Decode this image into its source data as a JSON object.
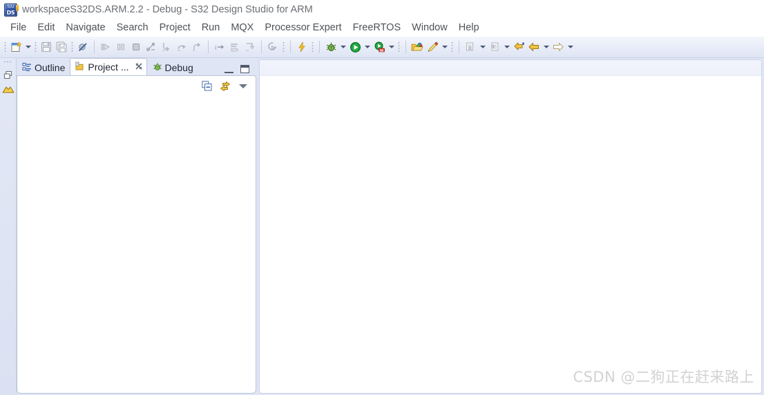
{
  "window": {
    "title": "workspaceS32DS.ARM.2.2 - Debug - S32 Design Studio for ARM",
    "app_icon": "s32ds-app-icon",
    "icon_top_text": "S32",
    "icon_bottom_text": "DS"
  },
  "menubar": {
    "items": [
      {
        "label": "File"
      },
      {
        "label": "Edit"
      },
      {
        "label": "Navigate"
      },
      {
        "label": "Search"
      },
      {
        "label": "Project"
      },
      {
        "label": "Run"
      },
      {
        "label": "MQX"
      },
      {
        "label": "Processor Expert"
      },
      {
        "label": "FreeRTOS"
      },
      {
        "label": "Window"
      },
      {
        "label": "Help"
      }
    ]
  },
  "toolbar": {
    "groups": [
      {
        "buttons": [
          {
            "name": "new-wizard-button",
            "icon": "new-file-icon",
            "enabled": true,
            "has_dropdown": true
          },
          {
            "name": "save-button",
            "icon": "save-icon",
            "enabled": false
          },
          {
            "name": "save-all-button",
            "icon": "save-all-icon",
            "enabled": false
          },
          {
            "name": "skip-all-breakpoints-button",
            "icon": "skip-breakpoints-icon",
            "enabled": false
          }
        ]
      },
      {
        "buttons": [
          {
            "name": "resume-button",
            "icon": "resume-icon",
            "enabled": false
          },
          {
            "name": "suspend-button",
            "icon": "suspend-icon",
            "enabled": false
          },
          {
            "name": "terminate-button",
            "icon": "terminate-icon",
            "enabled": false
          },
          {
            "name": "disconnect-button",
            "icon": "disconnect-icon",
            "enabled": false
          },
          {
            "name": "step-into-button",
            "icon": "step-into-icon",
            "enabled": false
          },
          {
            "name": "step-over-button",
            "icon": "step-over-icon",
            "enabled": false
          },
          {
            "name": "step-return-button",
            "icon": "step-return-icon",
            "enabled": false
          }
        ]
      },
      {
        "buttons": [
          {
            "name": "instruction-stepping-button",
            "icon": "instruction-step-icon",
            "enabled": false
          },
          {
            "name": "drop-to-frame-button",
            "icon": "drop-to-frame-icon",
            "enabled": false
          },
          {
            "name": "step-into-selection-button",
            "icon": "step-into-selection-icon",
            "enabled": false
          }
        ]
      },
      {
        "buttons": [
          {
            "name": "restart-button",
            "icon": "restart-icon",
            "enabled": false
          }
        ]
      },
      {
        "buttons": [
          {
            "name": "build-button",
            "icon": "build-lightning-icon",
            "enabled": true
          }
        ]
      },
      {
        "buttons": [
          {
            "name": "debug-button",
            "icon": "debug-bug-icon",
            "enabled": true,
            "has_dropdown": true
          },
          {
            "name": "run-button",
            "icon": "run-play-icon",
            "enabled": true,
            "has_dropdown": true
          },
          {
            "name": "profile-button",
            "icon": "profile-icon",
            "enabled": true,
            "has_dropdown": true
          }
        ]
      },
      {
        "buttons": [
          {
            "name": "open-resource-button",
            "icon": "open-folder-icon",
            "enabled": true
          },
          {
            "name": "pin-editor-button",
            "icon": "marker-pencil-icon",
            "enabled": true,
            "has_dropdown": true
          }
        ]
      },
      {
        "buttons": [
          {
            "name": "next-annotation-button",
            "icon": "next-annotation-icon",
            "enabled": false,
            "has_dropdown": true
          },
          {
            "name": "previous-annotation-button",
            "icon": "previous-annotation-icon",
            "enabled": false,
            "has_dropdown": true
          },
          {
            "name": "last-edit-location-button",
            "icon": "last-edit-location-icon",
            "enabled": true
          },
          {
            "name": "back-button",
            "icon": "back-arrow-icon",
            "enabled": true,
            "has_dropdown": true
          },
          {
            "name": "forward-button",
            "icon": "forward-arrow-icon",
            "enabled": false,
            "has_dropdown": true
          }
        ]
      }
    ]
  },
  "fastview": {
    "items": [
      {
        "name": "restore-fastview-icon",
        "icon": "restore-icon"
      },
      {
        "name": "perspective-icon",
        "icon": "perspective-gold-icon"
      }
    ]
  },
  "view_stack": {
    "tabs": [
      {
        "name": "tab-outline",
        "label": "Outline",
        "icon": "outline-icon",
        "active": false,
        "closable": false
      },
      {
        "name": "tab-project-explorer",
        "label": "Project ...",
        "icon": "project-explorer-icon",
        "active": true,
        "closable": true
      },
      {
        "name": "tab-debug",
        "label": "Debug",
        "icon": "debug-bug-icon",
        "active": false,
        "closable": false
      }
    ],
    "controls": {
      "minimize": "Minimize",
      "maximize": "Maximize"
    },
    "view_toolbar": [
      {
        "name": "collapse-all-button",
        "icon": "collapse-all-icon"
      },
      {
        "name": "link-with-editor-button",
        "icon": "link-with-editor-icon"
      },
      {
        "name": "view-menu-button",
        "icon": "chevron-down-icon"
      }
    ],
    "content": {
      "items": []
    }
  },
  "editor_area": {
    "tabs": [],
    "content": ""
  },
  "watermark": {
    "text": "CSDN @二狗正在赶来路上"
  },
  "colors": {
    "toolbar_bg": "#e8ecf8",
    "workbench_bg": "#dfe5f4",
    "tab_active_bg": "#ffffff",
    "title_text": "#6b6f74",
    "menu_text": "#4e5257",
    "accent_gold": "#e8a92a",
    "accent_green": "#2f9e41",
    "watermark": "#d2d2d2"
  }
}
